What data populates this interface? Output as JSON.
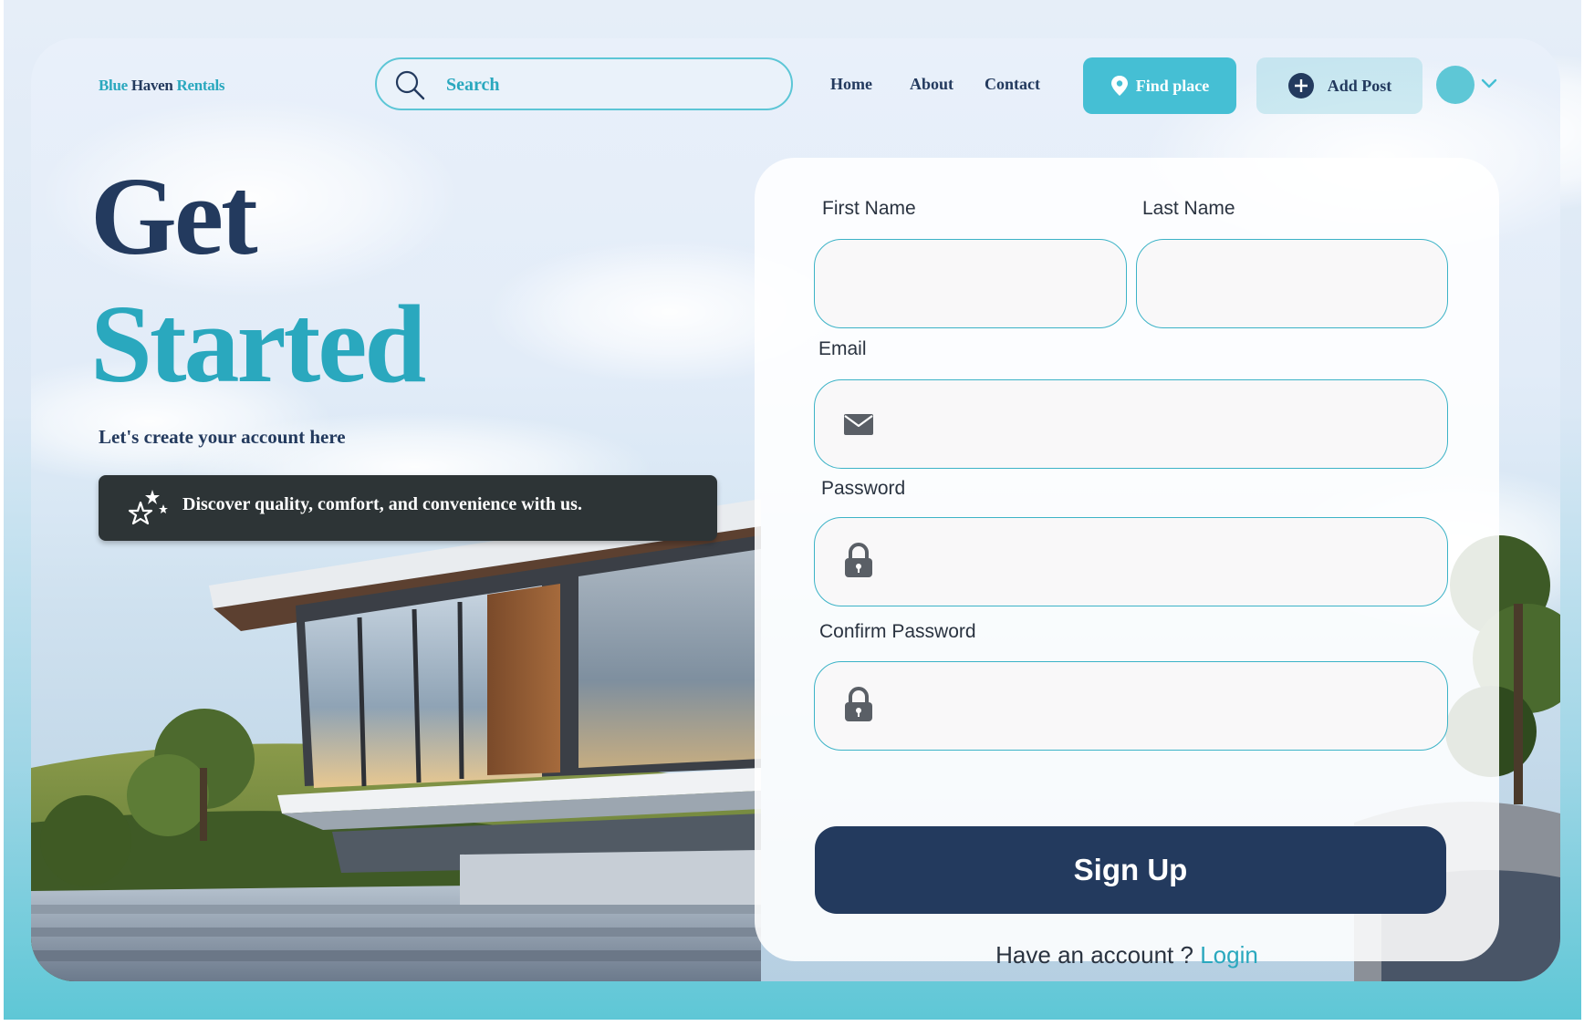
{
  "header": {
    "logo": {
      "part1": "Blue",
      "part2": "Haven",
      "part3": "Rentals"
    },
    "search": {
      "placeholder": "Search",
      "icon": "search-icon"
    },
    "nav": [
      {
        "label": "Home"
      },
      {
        "label": "About"
      },
      {
        "label": "Contact"
      }
    ],
    "find_place": {
      "label": "Find place",
      "icon": "map-pin-icon"
    },
    "add_post": {
      "label": "Add Post",
      "icon": "plus-circle-icon"
    },
    "avatar": {
      "icon": "chevron-down-icon"
    }
  },
  "hero": {
    "title_line1": "Get",
    "title_line2": "Started",
    "subtitle": "Let's create your account here",
    "banner": "Discover quality, comfort, and convenience with us."
  },
  "form": {
    "first_name_label": "First Name",
    "last_name_label": "Last Name",
    "email_label": "Email",
    "password_label": "Password",
    "confirm_password_label": "Confirm Password",
    "first_name_value": "",
    "last_name_value": "",
    "email_value": "",
    "password_value": "",
    "confirm_password_value": "",
    "signup_label": "Sign Up",
    "have_account_text": "Have an account ?",
    "login_label": "Login"
  },
  "colors": {
    "primary_navy": "#233a5e",
    "accent_teal": "#2aa8be",
    "button_teal": "#45bfd4",
    "banner_dark": "#2d3436"
  }
}
